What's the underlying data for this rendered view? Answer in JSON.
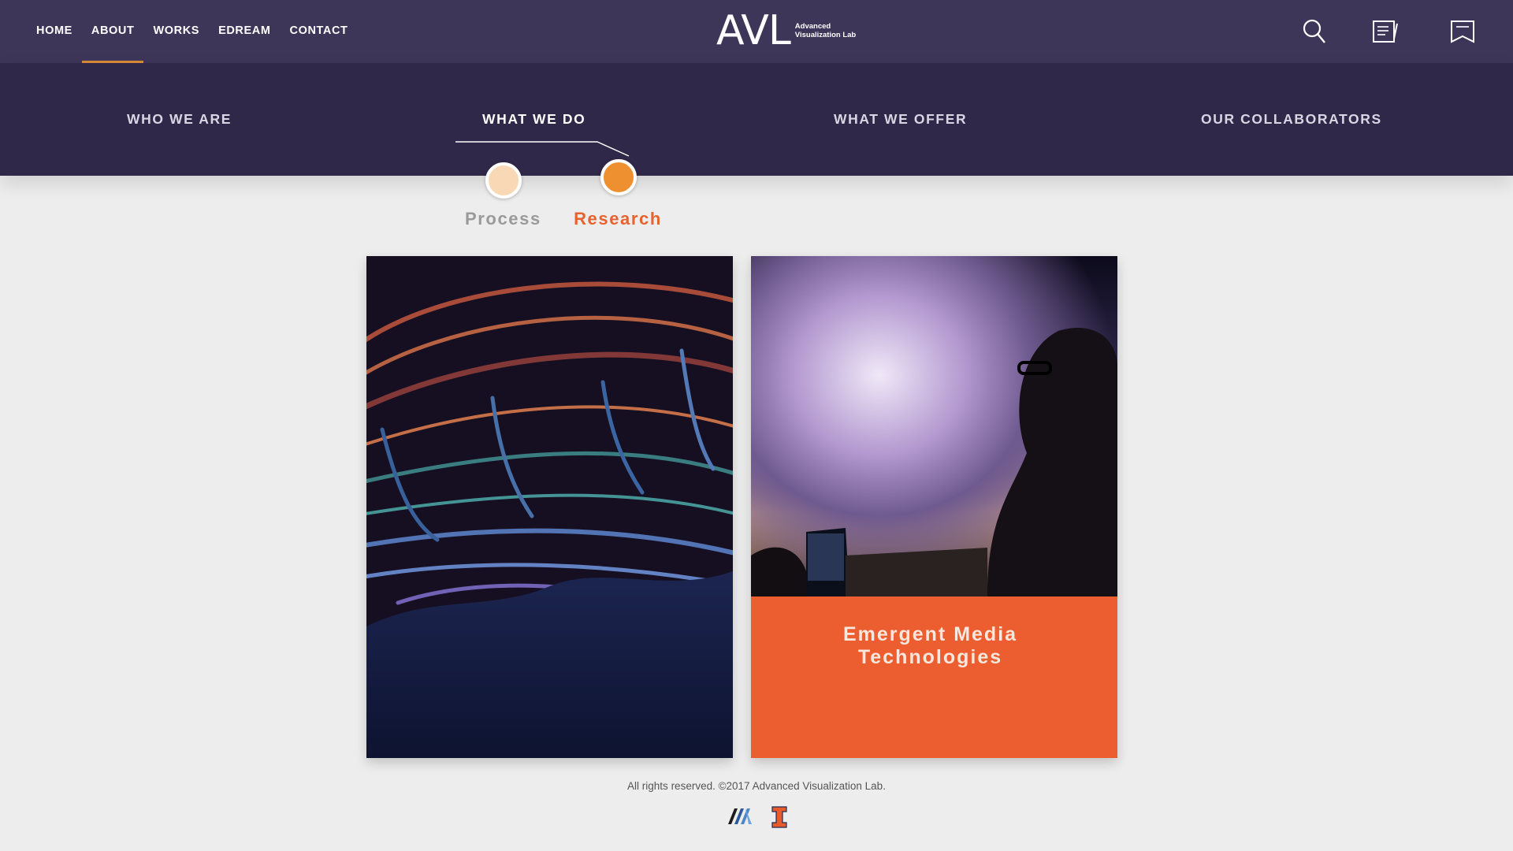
{
  "nav": {
    "links": [
      "HOME",
      "ABOUT",
      "WORKS",
      "EDREAM",
      "CONTACT"
    ],
    "active": "ABOUT",
    "logo": {
      "mark": "AVL",
      "line1": "Advanced",
      "line2": "Visualization Lab"
    },
    "icons": [
      "search-icon",
      "notes-icon",
      "bookmark-icon"
    ]
  },
  "subnav": {
    "items": [
      "WHO WE ARE",
      "WHAT WE DO",
      "WHAT WE OFFER",
      "OUR COLLABORATORS"
    ],
    "active": "WHAT WE DO"
  },
  "toggle": {
    "options": [
      "Process",
      "Research"
    ],
    "selected": "Research",
    "colors": {
      "process": "#f9d9b5",
      "research": "#ee8f30",
      "research_label": "#e6622e",
      "process_label": "#9a9a9a"
    }
  },
  "cards": [
    {
      "image": "flow-visualization",
      "title": ""
    },
    {
      "image": "planetarium-viewer",
      "title": "Emergent Media Technologies"
    }
  ],
  "footer": {
    "copyright": "All rights reserved. ©2017 Advanced Visualization Lab.",
    "logos": [
      "ncsa-logo",
      "illinois-logo"
    ]
  },
  "colors": {
    "nav_bg": "#3e3659",
    "subnav_bg": "#2f2849",
    "accent": "#ec5d2f",
    "underline": "#d98a3a"
  }
}
